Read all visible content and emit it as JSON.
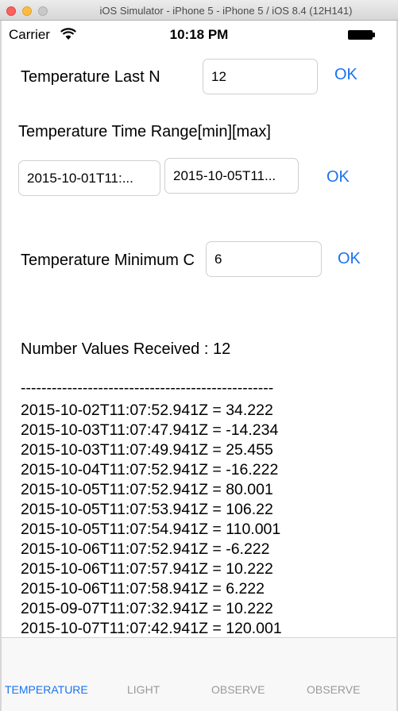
{
  "window": {
    "title": "iOS Simulator - iPhone 5 - iPhone 5 / iOS 8.4 (12H141)"
  },
  "status_bar": {
    "carrier": "Carrier",
    "time": "10:18 PM"
  },
  "last_n": {
    "label": "Temperature Last N",
    "value": "12",
    "ok": "OK"
  },
  "time_range": {
    "label": "Temperature Time Range[min][max]",
    "min_value": "2015-10-01T11:...",
    "max_value": "2015-10-05T11...",
    "ok": "OK"
  },
  "minimum": {
    "label": "Temperature Minimum C",
    "value": "6",
    "ok": "OK"
  },
  "results": {
    "count_label": "Number Values Received : 12",
    "separator": "-------------------------------------------------",
    "lines": [
      "2015-10-02T11:07:52.941Z = 34.222",
      "2015-10-03T11:07:47.941Z = -14.234",
      "2015-10-03T11:07:49.941Z = 25.455",
      "2015-10-04T11:07:52.941Z = -16.222",
      "2015-10-05T11:07:52.941Z = 80.001",
      "2015-10-05T11:07:53.941Z = 106.22",
      "2015-10-05T11:07:54.941Z = 110.001",
      "2015-10-06T11:07:52.941Z = -6.222",
      "2015-10-06T11:07:57.941Z = 10.222",
      "2015-10-06T11:07:58.941Z = 6.222",
      "2015-09-07T11:07:32.941Z = 10.222",
      "2015-10-07T11:07:42.941Z = 120.001"
    ]
  },
  "tabs": [
    {
      "label": "TEMPERATURE",
      "active": true
    },
    {
      "label": "LIGHT",
      "active": false
    },
    {
      "label": "OBSERVE",
      "active": false
    },
    {
      "label": "OBSERVE",
      "active": false
    }
  ],
  "colors": {
    "accent": "#1a73f0",
    "inactive_tab": "#9a9a9a"
  }
}
